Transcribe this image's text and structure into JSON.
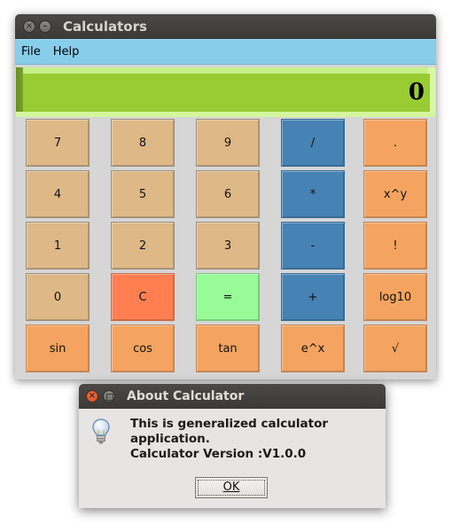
{
  "window": {
    "title": "Calculators",
    "close_glyph": "×",
    "minimize_glyph": "–"
  },
  "menu": {
    "items": [
      "File",
      "Help"
    ]
  },
  "display": {
    "value": "0"
  },
  "keypad": {
    "rows": [
      [
        "7",
        "8",
        "9",
        "/",
        "."
      ],
      [
        "4",
        "5",
        "6",
        "*",
        "x^y"
      ],
      [
        "1",
        "2",
        "3",
        "-",
        "!"
      ],
      [
        "0",
        "C",
        "=",
        "+",
        "log10"
      ],
      [
        "sin",
        "cos",
        "tan",
        "e^x",
        "√"
      ]
    ]
  },
  "colors": {
    "menu_bg": "#87ceeb",
    "display_bg": "#99cc33",
    "digit_key": "#deb887",
    "operator_key": "#4682b4",
    "function_key": "#f4a460",
    "clear_key": "#ff7f50",
    "equals_key": "#98fb98"
  },
  "dialog": {
    "title": "About Calculator",
    "icon": "lightbulb-info-icon",
    "close_glyph": "×",
    "message_lines": [
      "This is generalized calculator",
      "application.",
      "Calculator Version :V1.0.0"
    ],
    "ok_label": "OK"
  }
}
